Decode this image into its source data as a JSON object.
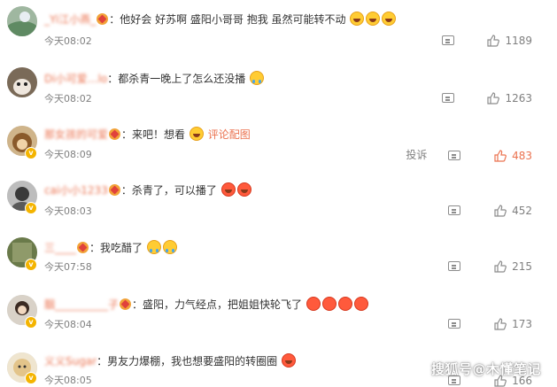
{
  "comments": [
    {
      "user": "_Yi江小燕_",
      "text_before": "他好会 好苏啊 盛阳小哥哥 抱我 虽然可能转不动",
      "emojis": [
        "laugh",
        "laugh",
        "laugh"
      ],
      "time": "今天08:02",
      "likes": "1189",
      "badge": false
    },
    {
      "user": "Di小可爱…lo",
      "text_before": "都杀青一晚上了怎么还没播",
      "emojis": [
        "cry"
      ],
      "time": "今天08:02",
      "likes": "1263",
      "badge": false
    },
    {
      "user": "那女孩的可爱",
      "text_before": "来吧！想看",
      "emojis": [
        "laugh"
      ],
      "link": "评论配图",
      "time": "今天08:09",
      "report": "投诉",
      "likes": "483",
      "badge": true,
      "liked": true
    },
    {
      "user": "cai小小1233",
      "text_before": "杀青了，可以播了",
      "emojis": [
        "red",
        "red"
      ],
      "time": "今天08:03",
      "likes": "452",
      "badge": true
    },
    {
      "user": "三____",
      "text_before": "我吃醋了",
      "emojis": [
        "cry",
        "cry"
      ],
      "time": "今天07:58",
      "likes": "215",
      "badge": true
    },
    {
      "user": "胭__________子",
      "text_before": "盛阳，力气经点，把姐姐快轮飞了",
      "emojis": [
        "red",
        "red",
        "red",
        "red"
      ],
      "time": "今天08:04",
      "likes": "173",
      "badge": true
    },
    {
      "user": "义义Sugar",
      "text_before": "男友力爆棚，我也想要盛阳的转圈圈",
      "emojis": [
        "red"
      ],
      "time": "今天08:05",
      "likes": "166",
      "badge": true
    }
  ],
  "watermark": "搜狐号@木懂笔记",
  "colors": {
    "accent": "#eb7350",
    "muted": "#808080",
    "badge": "#f4b400"
  },
  "icons": [
    "reply-icon",
    "thumbs-up-icon",
    "vip-icon",
    "verified-badge-icon"
  ]
}
